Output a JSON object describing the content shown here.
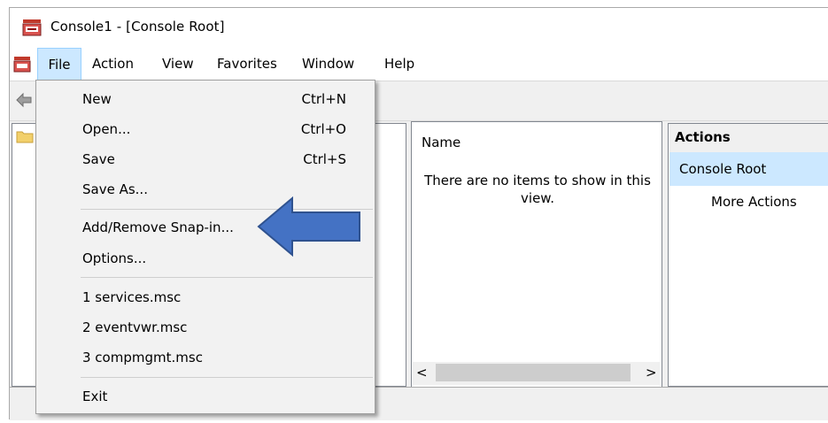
{
  "window": {
    "title": "Console1 - [Console Root]"
  },
  "menubar": {
    "items": [
      "File",
      "Action",
      "View",
      "Favorites",
      "Window",
      "Help"
    ]
  },
  "file_menu": {
    "items": [
      {
        "label": "New",
        "shortcut": "Ctrl+N"
      },
      {
        "label": "Open...",
        "shortcut": "Ctrl+O"
      },
      {
        "label": "Save",
        "shortcut": "Ctrl+S"
      },
      {
        "label": "Save As...",
        "shortcut": ""
      },
      {
        "label": "Add/Remove Snap-in...",
        "shortcut": ""
      },
      {
        "label": "Options...",
        "shortcut": ""
      },
      {
        "label": "1 services.msc",
        "shortcut": ""
      },
      {
        "label": "2 eventvwr.msc",
        "shortcut": ""
      },
      {
        "label": "3 compmgmt.msc",
        "shortcut": ""
      },
      {
        "label": "Exit",
        "shortcut": ""
      }
    ]
  },
  "list_pane": {
    "column_header": "Name",
    "empty_text": "There are no items to show in this view."
  },
  "actions_pane": {
    "header": "Actions",
    "selected": "Console Root",
    "more": "More Actions"
  },
  "scrollbar": {
    "left_glyph": "<",
    "right_glyph": ">"
  },
  "colors": {
    "menu_active": "#cce8ff",
    "arrow_fill": "#4472c4",
    "arrow_stroke": "#2f528f"
  }
}
